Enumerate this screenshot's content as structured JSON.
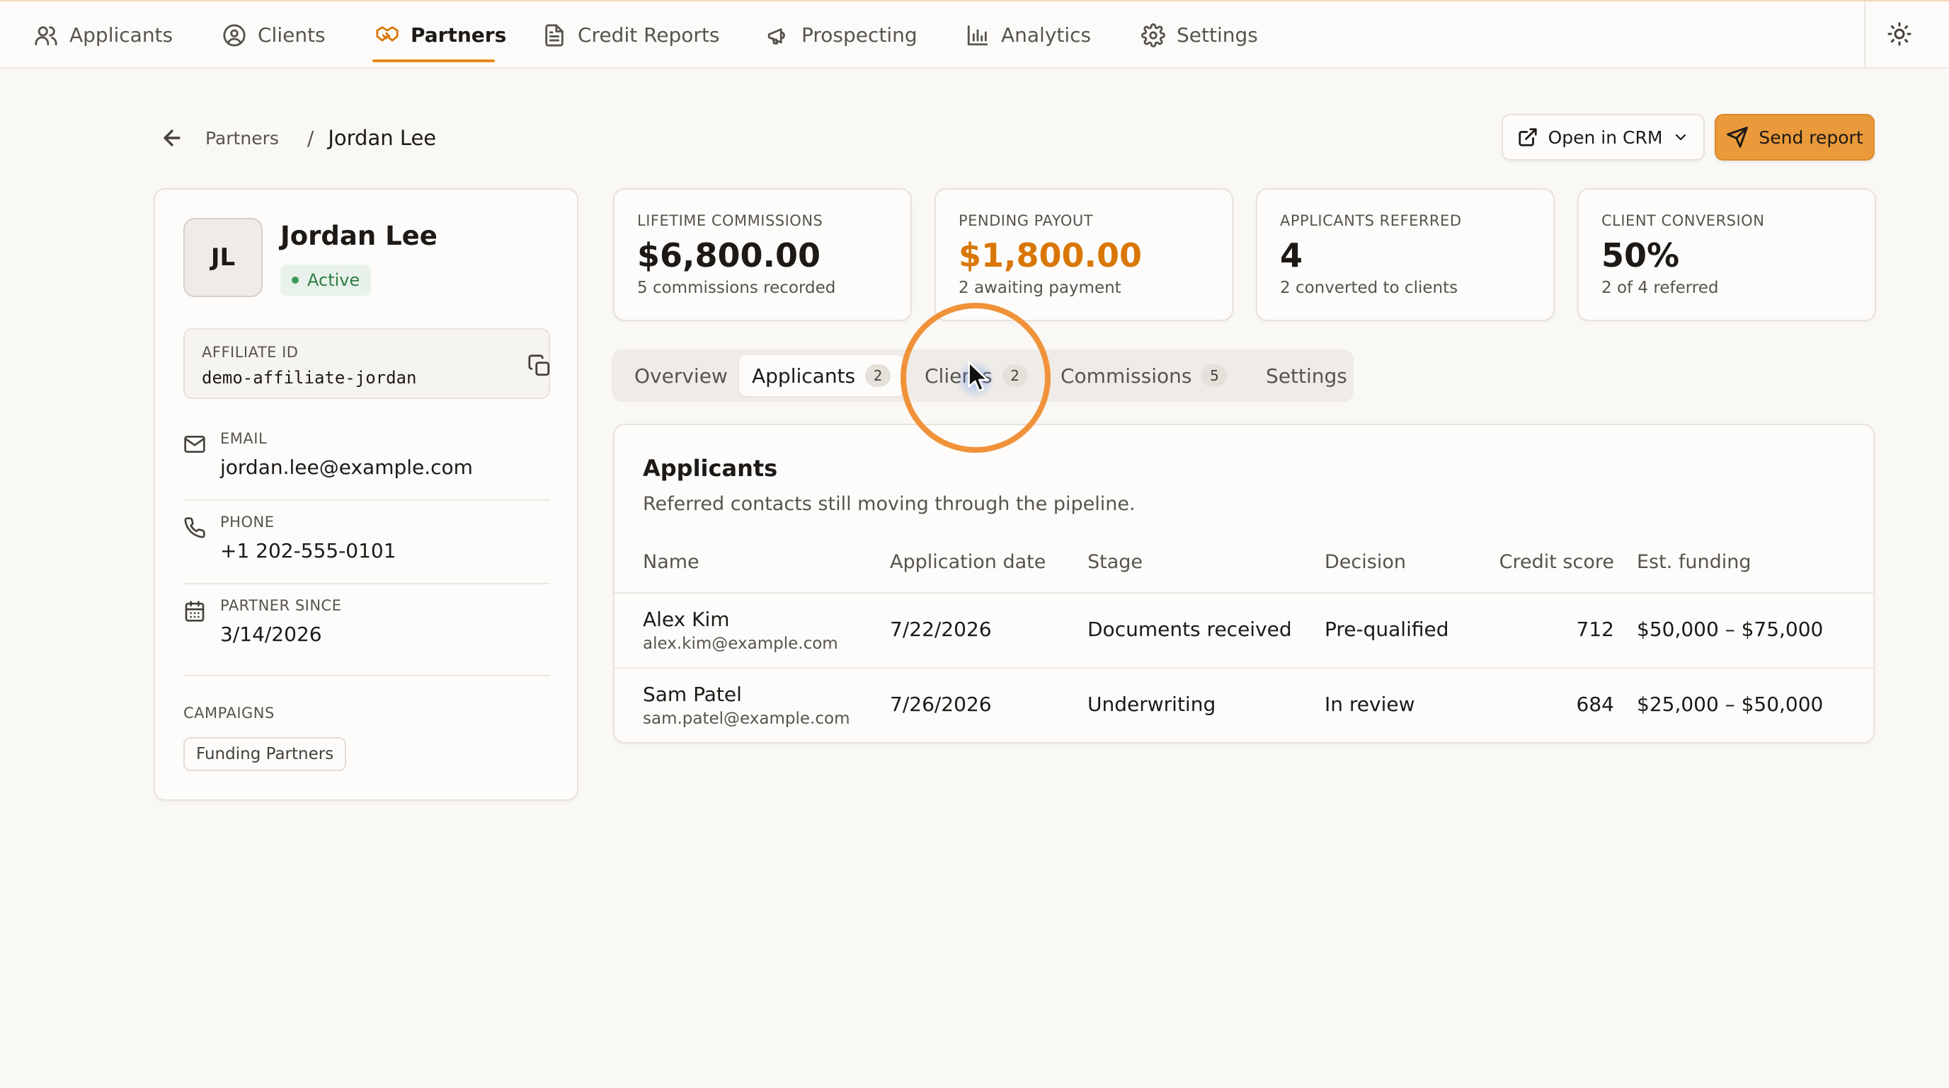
{
  "nav": {
    "items": [
      {
        "label": "Applicants",
        "icon": "users-icon"
      },
      {
        "label": "Clients",
        "icon": "user-circle-icon"
      },
      {
        "label": "Partners",
        "icon": "handshake-icon",
        "active": true
      },
      {
        "label": "Credit Reports",
        "icon": "file-text-icon"
      },
      {
        "label": "Prospecting",
        "icon": "megaphone-icon"
      },
      {
        "label": "Analytics",
        "icon": "bar-chart-icon"
      },
      {
        "label": "Settings",
        "icon": "gear-icon"
      }
    ],
    "theme_icon": "sun-icon"
  },
  "breadcrumb": {
    "parent": "Partners",
    "separator": "/",
    "current": "Jordan Lee"
  },
  "actions": {
    "open_crm": "Open in CRM",
    "send_report": "Send report"
  },
  "profile": {
    "initials": "JL",
    "name": "Jordan Lee",
    "status": "Active",
    "affiliate_label": "AFFILIATE ID",
    "affiliate_id": "demo-affiliate-jordan",
    "email_label": "EMAIL",
    "email": "jordan.lee@example.com",
    "phone_label": "PHONE",
    "phone": "+1 202-555-0101",
    "since_label": "PARTNER SINCE",
    "since": "3/14/2026",
    "campaigns_label": "CAMPAIGNS",
    "campaigns": [
      "Funding Partners"
    ]
  },
  "stats": [
    {
      "label": "LIFETIME COMMISSIONS",
      "value": "$6,800.00",
      "sub": "5 commissions recorded"
    },
    {
      "label": "PENDING PAYOUT",
      "value": "$1,800.00",
      "sub": "2 awaiting payment"
    },
    {
      "label": "APPLICANTS REFERRED",
      "value": "4",
      "sub": "2 converted to clients"
    },
    {
      "label": "CLIENT CONVERSION",
      "value": "50%",
      "sub": "2 of 4 referred"
    }
  ],
  "tabs": [
    {
      "label": "Overview"
    },
    {
      "label": "Applicants",
      "count": "2",
      "active": true
    },
    {
      "label": "Clients",
      "count": "2"
    },
    {
      "label": "Commissions",
      "count": "5"
    },
    {
      "label": "Settings"
    }
  ],
  "applicants": {
    "title": "Applicants",
    "description": "Referred contacts still moving through the pipeline.",
    "columns": [
      "Name",
      "Application date",
      "Stage",
      "Decision",
      "Credit score",
      "Est. funding"
    ],
    "rows": [
      {
        "name": "Alex Kim",
        "email": "alex.kim@example.com",
        "date": "7/22/2026",
        "stage": "Documents received",
        "decision": "Pre-qualified",
        "score": "712",
        "funding": "$50,000 – $75,000"
      },
      {
        "name": "Sam Patel",
        "email": "sam.patel@example.com",
        "date": "7/26/2026",
        "stage": "Underwriting",
        "decision": "In review",
        "score": "684",
        "funding": "$25,000 – $50,000"
      }
    ]
  },
  "colors": {
    "accent": "#e88a1a",
    "send_button": "#ea9a3a",
    "pending_value": "#d97706",
    "active_badge": "#2f7d47",
    "cursor_ring": "#f0923a"
  }
}
